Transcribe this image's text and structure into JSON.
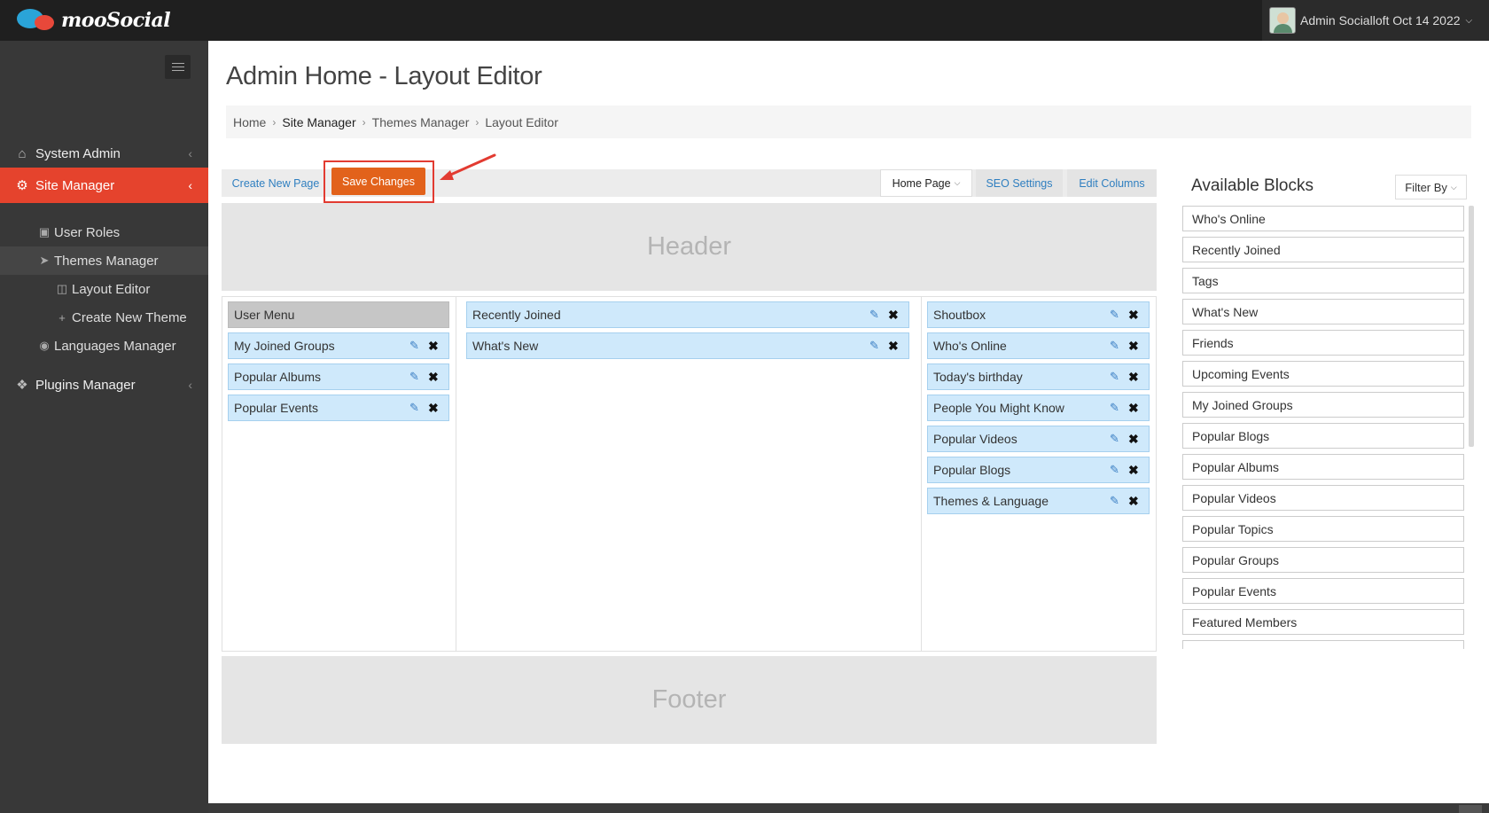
{
  "brand": {
    "name": "mooSocial"
  },
  "user": {
    "name": "Admin Socialloft Oct 14 2022"
  },
  "sidebar": {
    "system_admin": "System Admin",
    "site_manager": "Site Manager",
    "sub": {
      "user_roles": "User Roles",
      "themes_manager": "Themes Manager",
      "layout_editor": "Layout Editor",
      "create_new_theme": "Create New Theme",
      "languages_manager": "Languages Manager"
    },
    "plugins_manager": "Plugins Manager"
  },
  "page": {
    "title": "Admin Home - Layout Editor"
  },
  "breadcrumb": [
    "Home",
    "Site Manager",
    "Themes Manager",
    "Layout Editor"
  ],
  "toolbar": {
    "create_new_page": "Create New Page",
    "save_changes": "Save Changes",
    "page_select": "Home Page",
    "seo_settings": "SEO Settings",
    "edit_columns": "Edit Columns"
  },
  "regions": {
    "header": "Header",
    "footer": "Footer"
  },
  "columns": {
    "left": {
      "fixed": "User Menu",
      "blocks": [
        "My Joined Groups",
        "Popular Albums",
        "Popular Events"
      ]
    },
    "center": {
      "blocks": [
        "Recently Joined",
        "What's New"
      ]
    },
    "right": {
      "blocks": [
        "Shoutbox",
        "Who's Online",
        "Today's birthday",
        "People You Might Know",
        "Popular Videos",
        "Popular Blogs",
        "Themes & Language"
      ]
    }
  },
  "available": {
    "title": "Available Blocks",
    "filter": "Filter By",
    "items": [
      "Who's Online",
      "Recently Joined",
      "Tags",
      "What's New",
      "Friends",
      "Upcoming Events",
      "My Joined Groups",
      "Popular Blogs",
      "Popular Albums",
      "Popular Videos",
      "Popular Topics",
      "Popular Groups",
      "Popular Events",
      "Featured Members"
    ]
  },
  "colors": {
    "accent": "#e5432d",
    "save_button": "#e2621b",
    "block_bg": "#cfe9fb",
    "highlight": "#e23b31"
  }
}
